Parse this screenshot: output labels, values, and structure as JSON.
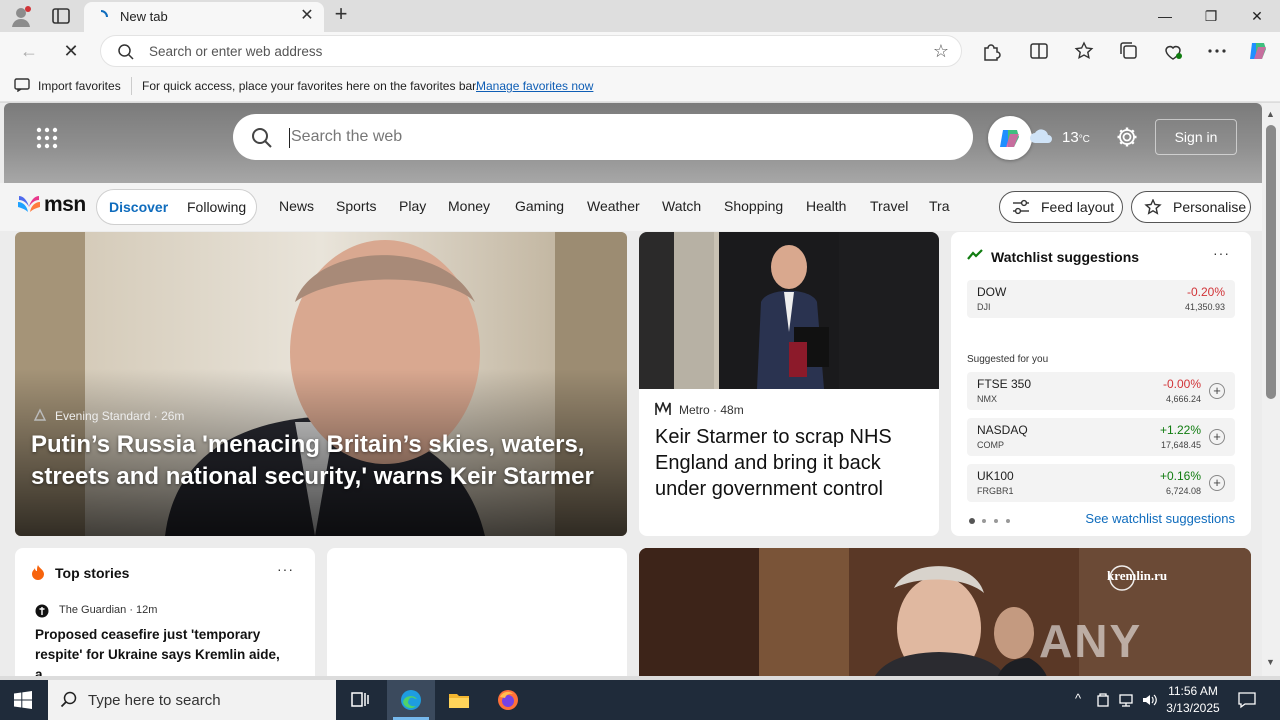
{
  "browser": {
    "tab_title": "New tab",
    "address_placeholder": "Search or enter web address"
  },
  "favorites_bar": {
    "import_label": "Import favorites",
    "message": "For quick access, place your favorites here on the favorites bar.",
    "manage_link": "Manage favorites now"
  },
  "msn_header": {
    "search_placeholder": "Search the web",
    "weather_temp": "13",
    "weather_unit": "°C",
    "sign_in": "Sign in"
  },
  "msn_nav": {
    "logo": "msn",
    "discover": "Discover",
    "following": "Following",
    "items": [
      "News",
      "Sports",
      "Play",
      "Money",
      "Gaming",
      "Weather",
      "Watch",
      "Shopping",
      "Health",
      "Travel",
      "Tra"
    ],
    "feed_layout": "Feed layout",
    "personalise": "Personalise"
  },
  "hero": {
    "source": "Evening Standard",
    "time": "26m",
    "title": "Putin’s Russia 'menacing Britain’s skies, waters, streets and national security,' warns Keir Starmer"
  },
  "card2": {
    "source": "Metro",
    "time": "48m",
    "title": "Keir Starmer to scrap NHS England and bring it back under government control"
  },
  "watchlist": {
    "title": "Watchlist suggestions",
    "more": "···",
    "suggested_label": "Suggested for you",
    "see_link": "See watchlist suggestions",
    "rows": [
      {
        "name": "DOW",
        "sub": "DJI",
        "change": "-0.20%",
        "value": "41,350.93",
        "trend": "neg"
      },
      {
        "name": "FTSE 350",
        "sub": "NMX",
        "change": "-0.00%",
        "value": "4,666.24",
        "trend": "neg"
      },
      {
        "name": "NASDAQ",
        "sub": "COMP",
        "change": "+1.22%",
        "value": "17,648.45",
        "trend": "pos"
      },
      {
        "name": "UK100",
        "sub": "FRGBR1",
        "change": "+0.16%",
        "value": "6,724.08",
        "trend": "pos"
      }
    ],
    "colors": {
      "negative": "#d13438",
      "positive": "#107c10"
    }
  },
  "top_stories": {
    "title": "Top stories",
    "more": "···",
    "source": "The Guardian",
    "time": "12m",
    "headline": "Proposed ceasefire just 'temporary respite' for Ukraine says Kremlin aide, a..."
  },
  "video_card": {
    "watermark_site": "kremlin.ru",
    "overlay_text": "ANY RUN"
  },
  "taskbar": {
    "search_placeholder": "Type here to search",
    "time": "11:56 AM",
    "date": "3/13/2025"
  }
}
